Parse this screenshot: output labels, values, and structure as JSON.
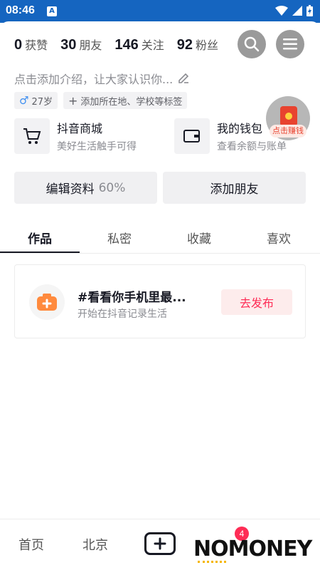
{
  "status_bar": {
    "time": "08:46",
    "notification_letter": "A"
  },
  "stats": [
    {
      "value": "0",
      "label": "获赞"
    },
    {
      "value": "30",
      "label": "朋友"
    },
    {
      "value": "146",
      "label": "关注"
    },
    {
      "value": "92",
      "label": "粉丝"
    }
  ],
  "header": {
    "search_icon": "search-icon",
    "menu_icon": "hamburger-menu-icon"
  },
  "profile": {
    "bio_placeholder": "点击添加介绍，让大家认识你...",
    "gender_age": "27岁",
    "add_location_tag": "添加所在地、学校等标签"
  },
  "redpacket": {
    "label": "点击赚钱"
  },
  "services": [
    {
      "title": "抖音商城",
      "subtitle": "美好生活触手可得",
      "icon": "shopping-cart-icon"
    },
    {
      "title": "我的钱包",
      "subtitle": "查看余额与账单",
      "icon": "wallet-icon"
    }
  ],
  "actions": {
    "edit_profile": "编辑资料",
    "edit_progress": "60%",
    "add_friends": "添加朋友"
  },
  "tabs": [
    {
      "label": "作品",
      "active": true
    },
    {
      "label": "私密",
      "active": false
    },
    {
      "label": "收藏",
      "active": false
    },
    {
      "label": "喜欢",
      "active": false
    }
  ],
  "publish_card": {
    "title": "#看看你手机里最...",
    "subtitle": "开始在抖音记录生活",
    "button": "去发布"
  },
  "bottom_nav": {
    "home": "首页",
    "city": "北京",
    "message_badge": "4",
    "watermark": "NOMONEY"
  },
  "colors": {
    "accent": "#fe2c55",
    "status_bar": "#1565c0",
    "male": "#3d8ef0"
  }
}
